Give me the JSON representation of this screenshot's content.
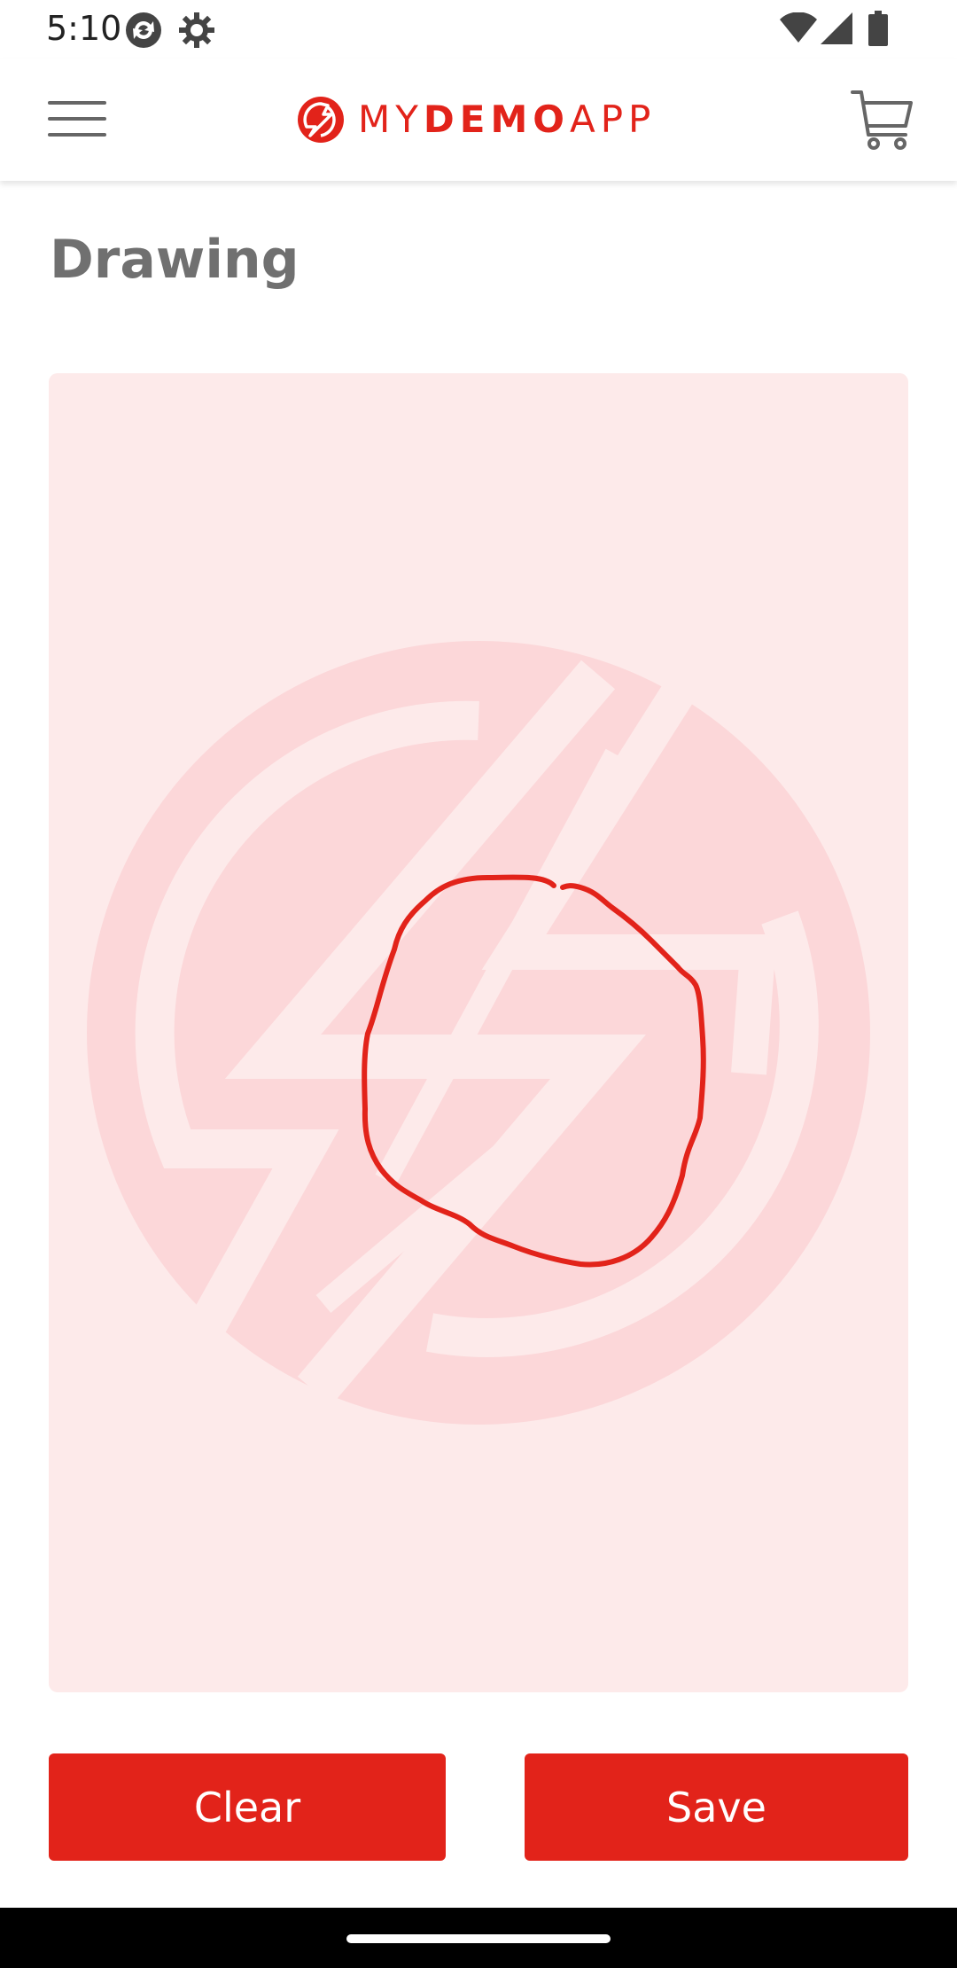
{
  "status_bar": {
    "time": "5:10",
    "icons": [
      "sync-icon",
      "settings-gear-icon",
      "wifi-icon",
      "cell-signal-icon",
      "battery-icon"
    ]
  },
  "header": {
    "logo_prefix": "MY",
    "logo_bold": "DEMO",
    "logo_suffix": "APP",
    "menu_icon": "hamburger-menu-icon",
    "cart_icon": "cart-icon",
    "brand_color": "#e2231a"
  },
  "page": {
    "title": "Drawing"
  },
  "canvas": {
    "background_color": "#fdeaea",
    "watermark_color": "#fcd7d9",
    "stroke_color": "#e2231a"
  },
  "actions": {
    "clear_label": "Clear",
    "save_label": "Save"
  }
}
